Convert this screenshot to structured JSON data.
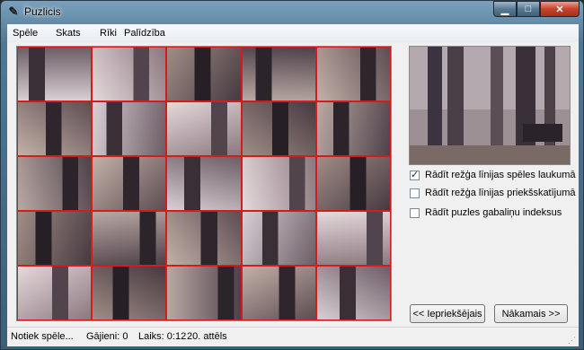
{
  "window": {
    "title": "Puzlicis"
  },
  "menu": [
    "Spēle",
    "Skats",
    "Rīki",
    "Palīdzība"
  ],
  "board": {
    "rows": 5,
    "cols": 5,
    "grid_color": "#d51c1c"
  },
  "options": [
    {
      "label": "Rādīt režģa līnijas spēles laukumā",
      "checked": true
    },
    {
      "label": "Rādīt režģa līnijas priekšskatījumā",
      "checked": false
    },
    {
      "label": "Rādīt puzles gabaliņu indeksus",
      "checked": false
    }
  ],
  "buttons": {
    "prev": "<< Iepriekšējais",
    "next": "Nākamais >>"
  },
  "status": {
    "state": "Notiek spēle...",
    "moves": "Gājieni: 0",
    "time": "Laiks: 0:12",
    "image": "20. attēls"
  },
  "colors": {
    "accent_close": "#c5432b",
    "title_bar": "#4f7894"
  }
}
